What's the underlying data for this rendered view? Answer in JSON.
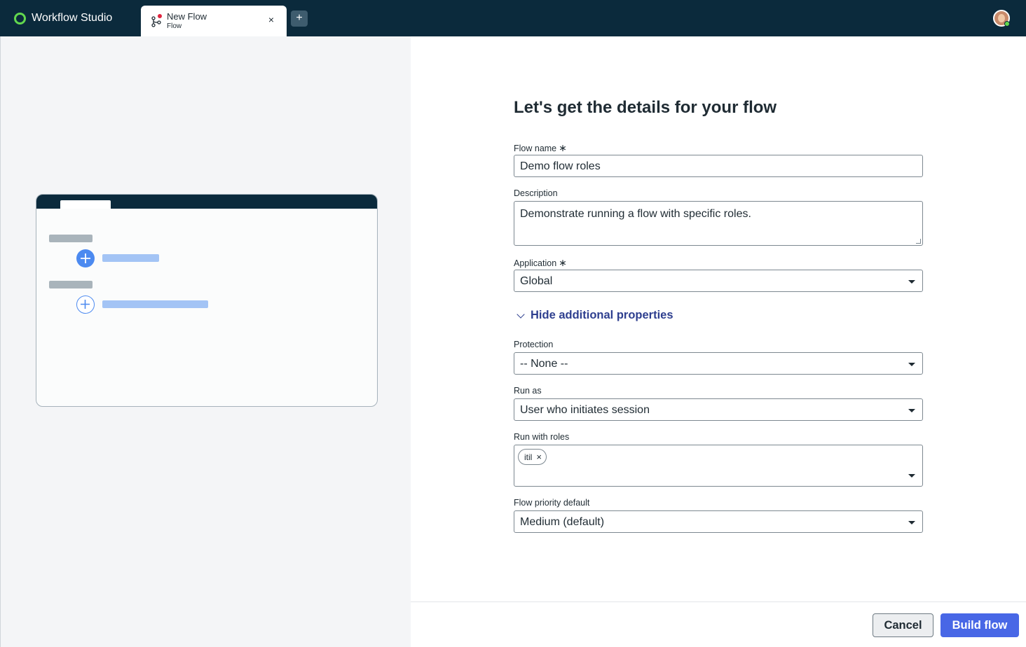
{
  "app": {
    "title": "Workflow Studio"
  },
  "tab": {
    "title": "New Flow",
    "subtitle": "Flow",
    "close": "×",
    "add": "+"
  },
  "form": {
    "heading": "Let's get the details for your flow",
    "flow_name": {
      "label": "Flow name",
      "required_mark": "∗",
      "value": "Demo flow roles"
    },
    "description": {
      "label": "Description",
      "value": "Demonstrate running a flow with specific roles."
    },
    "application": {
      "label": "Application",
      "required_mark": "∗",
      "value": "Global"
    },
    "toggle_label": "Hide additional properties",
    "protection": {
      "label": "Protection",
      "value": "-- None --"
    },
    "run_as": {
      "label": "Run as",
      "value": "User who initiates session"
    },
    "run_with_roles": {
      "label": "Run with roles",
      "roles": [
        "itil"
      ],
      "remove": "×"
    },
    "priority": {
      "label": "Flow priority default",
      "value": "Medium (default)"
    }
  },
  "footer": {
    "cancel": "Cancel",
    "build": "Build flow"
  },
  "colors": {
    "topbar": "#0b2a3c",
    "accent": "#4867e6",
    "link": "#2e3f8f",
    "logo": "#62d84e"
  }
}
